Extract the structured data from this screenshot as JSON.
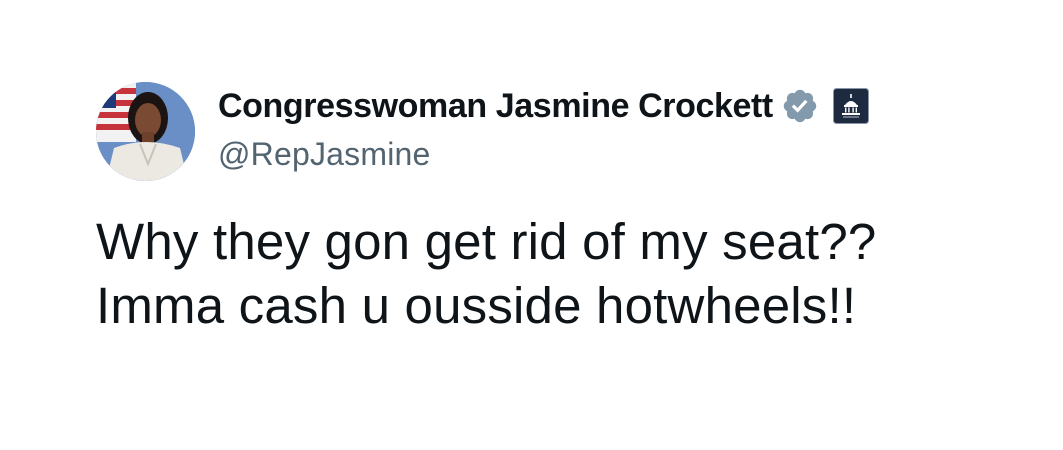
{
  "tweet": {
    "author": {
      "display_name": "Congresswoman Jasmine Crockett",
      "handle": "@RepJasmine",
      "avatar": "profile-photo",
      "verified_icon": "verified-badge-icon",
      "verified_color": "#829aab",
      "affiliation_icon": "us-capitol-icon"
    },
    "text_lines": [
      "Why they gon get rid of my seat??",
      "Imma cash u ousside hotwheels!!"
    ]
  },
  "colors": {
    "text": "#0f1419",
    "handle": "#536471",
    "background": "#ffffff"
  }
}
